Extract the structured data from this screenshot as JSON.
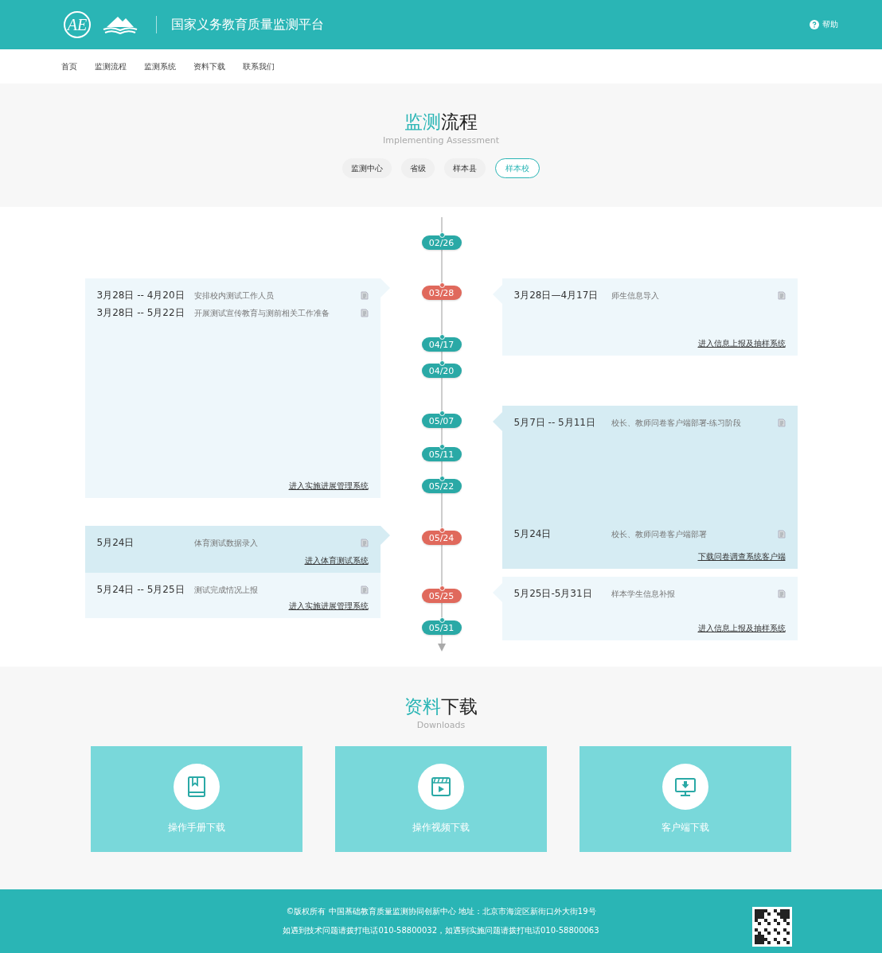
{
  "header": {
    "logo_text": "AE",
    "title": "国家义务教育质量监测平台",
    "help": "帮助"
  },
  "nav": [
    "首页",
    "监测流程",
    "监测系统",
    "资料下载",
    "联系我们"
  ],
  "process": {
    "title_accent": "监测",
    "title_rest": "流程",
    "subtitle": "Implementing Assessment",
    "tabs": [
      {
        "label": "监测中心",
        "selected": false
      },
      {
        "label": "省级",
        "selected": false
      },
      {
        "label": "样本县",
        "selected": false
      },
      {
        "label": "样本校",
        "selected": true
      }
    ]
  },
  "timeline": {
    "dates": [
      {
        "label": "02/26",
        "color": "#2aa9a6"
      },
      {
        "label": "03/28",
        "color": "#e0695c"
      },
      {
        "label": "04/17",
        "color": "#2aa9a6"
      },
      {
        "label": "04/20",
        "color": "#2aa9a6"
      },
      {
        "label": "05/07",
        "color": "#2aa9a6"
      },
      {
        "label": "05/11",
        "color": "#2aa9a6"
      },
      {
        "label": "05/22",
        "color": "#2aa9a6"
      },
      {
        "label": "05/24",
        "color": "#e0695c"
      },
      {
        "label": "05/25",
        "color": "#e0695c"
      },
      {
        "label": "05/31",
        "color": "#2aa9a6"
      }
    ],
    "left": [
      {
        "blocks": [
          {
            "highlighted": false,
            "entries": [
              {
                "date": "3月28日 -- 4月20日",
                "task": "安排校内测试工作人员"
              },
              {
                "date": "3月28日 -- 5月22日",
                "task": "开展测试宣传教育与测前相关工作准备"
              }
            ],
            "link": "进入实施进展管理系统"
          }
        ]
      },
      {
        "blocks": [
          {
            "highlighted": true,
            "entries": [
              {
                "date": "5月24日",
                "task": "体育测试数据录入"
              }
            ],
            "link": "进入体育测试系统"
          },
          {
            "highlighted": false,
            "entries": [
              {
                "date": "5月24日 -- 5月25日",
                "task": "测试完成情况上报"
              }
            ],
            "link": "进入实施进展管理系统"
          }
        ]
      }
    ],
    "right": [
      {
        "blocks": [
          {
            "highlighted": false,
            "entries": [
              {
                "date": "3月28日—4月17日",
                "task": "师生信息导入"
              }
            ],
            "link": "进入信息上报及抽样系统"
          }
        ]
      },
      {
        "blocks": [
          {
            "highlighted": true,
            "entries": [
              {
                "date": "5月7日 -- 5月11日",
                "task": "校长、教师问卷客户端部署-练习阶段"
              }
            ]
          },
          {
            "highlighted": true,
            "entries": [
              {
                "date": "5月24日",
                "task": "校长、教师问卷客户端部署"
              }
            ],
            "link": "下载问卷调查系统客户端"
          }
        ]
      },
      {
        "blocks": [
          {
            "highlighted": false,
            "entries": [
              {
                "date": "5月25日-5月31日",
                "task": "样本学生信息补报"
              }
            ],
            "link": "进入信息上报及抽样系统"
          }
        ]
      }
    ]
  },
  "downloads": {
    "title_accent": "资料",
    "title_rest": "下载",
    "subtitle": "Downloads",
    "items": [
      {
        "kind": "manual",
        "label": "操作手册下载"
      },
      {
        "kind": "video",
        "label": "操作视频下载"
      },
      {
        "kind": "client",
        "label": "客户端下载"
      }
    ]
  },
  "footer": {
    "lines": [
      "©版权所有 中国基础教育质量监测协同创新中心 地址：北京市海淀区新街口外大街19号",
      "如遇到技术问题请拨打电话010-58800032，如遇到实施问题请拨打电话010-58800063"
    ]
  }
}
